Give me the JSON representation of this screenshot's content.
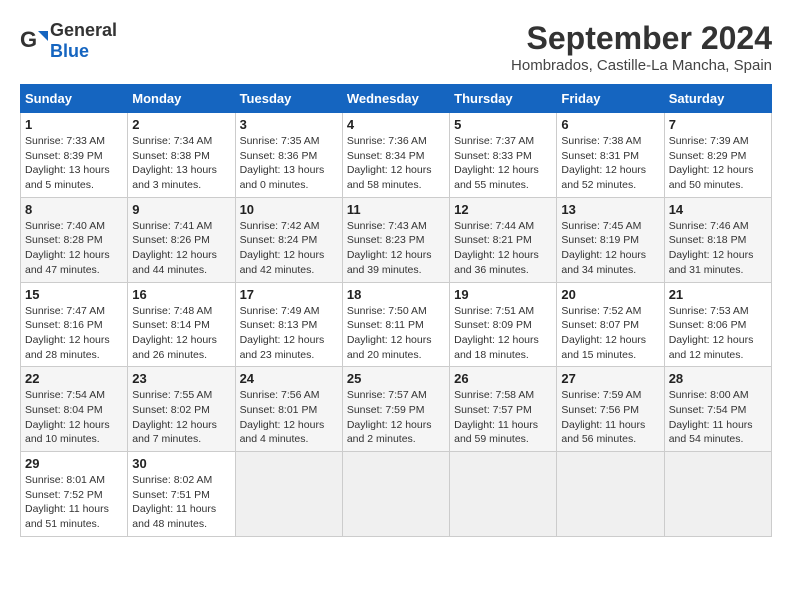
{
  "header": {
    "logo_general": "General",
    "logo_blue": "Blue",
    "month_title": "September 2024",
    "location": "Hombrados, Castille-La Mancha, Spain"
  },
  "calendar": {
    "days_of_week": [
      "Sunday",
      "Monday",
      "Tuesday",
      "Wednesday",
      "Thursday",
      "Friday",
      "Saturday"
    ],
    "weeks": [
      [
        null,
        null,
        null,
        null,
        null,
        null,
        null
      ]
    ],
    "cells": [
      {
        "day": 1,
        "col": 0,
        "sunrise": "7:33 AM",
        "sunset": "8:39 PM",
        "daylight": "13 hours and 5 minutes."
      },
      {
        "day": 2,
        "col": 1,
        "sunrise": "7:34 AM",
        "sunset": "8:38 PM",
        "daylight": "13 hours and 3 minutes."
      },
      {
        "day": 3,
        "col": 2,
        "sunrise": "7:35 AM",
        "sunset": "8:36 PM",
        "daylight": "13 hours and 0 minutes."
      },
      {
        "day": 4,
        "col": 3,
        "sunrise": "7:36 AM",
        "sunset": "8:34 PM",
        "daylight": "12 hours and 58 minutes."
      },
      {
        "day": 5,
        "col": 4,
        "sunrise": "7:37 AM",
        "sunset": "8:33 PM",
        "daylight": "12 hours and 55 minutes."
      },
      {
        "day": 6,
        "col": 5,
        "sunrise": "7:38 AM",
        "sunset": "8:31 PM",
        "daylight": "12 hours and 52 minutes."
      },
      {
        "day": 7,
        "col": 6,
        "sunrise": "7:39 AM",
        "sunset": "8:29 PM",
        "daylight": "12 hours and 50 minutes."
      },
      {
        "day": 8,
        "col": 0,
        "sunrise": "7:40 AM",
        "sunset": "8:28 PM",
        "daylight": "12 hours and 47 minutes."
      },
      {
        "day": 9,
        "col": 1,
        "sunrise": "7:41 AM",
        "sunset": "8:26 PM",
        "daylight": "12 hours and 44 minutes."
      },
      {
        "day": 10,
        "col": 2,
        "sunrise": "7:42 AM",
        "sunset": "8:24 PM",
        "daylight": "12 hours and 42 minutes."
      },
      {
        "day": 11,
        "col": 3,
        "sunrise": "7:43 AM",
        "sunset": "8:23 PM",
        "daylight": "12 hours and 39 minutes."
      },
      {
        "day": 12,
        "col": 4,
        "sunrise": "7:44 AM",
        "sunset": "8:21 PM",
        "daylight": "12 hours and 36 minutes."
      },
      {
        "day": 13,
        "col": 5,
        "sunrise": "7:45 AM",
        "sunset": "8:19 PM",
        "daylight": "12 hours and 34 minutes."
      },
      {
        "day": 14,
        "col": 6,
        "sunrise": "7:46 AM",
        "sunset": "8:18 PM",
        "daylight": "12 hours and 31 minutes."
      },
      {
        "day": 15,
        "col": 0,
        "sunrise": "7:47 AM",
        "sunset": "8:16 PM",
        "daylight": "12 hours and 28 minutes."
      },
      {
        "day": 16,
        "col": 1,
        "sunrise": "7:48 AM",
        "sunset": "8:14 PM",
        "daylight": "12 hours and 26 minutes."
      },
      {
        "day": 17,
        "col": 2,
        "sunrise": "7:49 AM",
        "sunset": "8:13 PM",
        "daylight": "12 hours and 23 minutes."
      },
      {
        "day": 18,
        "col": 3,
        "sunrise": "7:50 AM",
        "sunset": "8:11 PM",
        "daylight": "12 hours and 20 minutes."
      },
      {
        "day": 19,
        "col": 4,
        "sunrise": "7:51 AM",
        "sunset": "8:09 PM",
        "daylight": "12 hours and 18 minutes."
      },
      {
        "day": 20,
        "col": 5,
        "sunrise": "7:52 AM",
        "sunset": "8:07 PM",
        "daylight": "12 hours and 15 minutes."
      },
      {
        "day": 21,
        "col": 6,
        "sunrise": "7:53 AM",
        "sunset": "8:06 PM",
        "daylight": "12 hours and 12 minutes."
      },
      {
        "day": 22,
        "col": 0,
        "sunrise": "7:54 AM",
        "sunset": "8:04 PM",
        "daylight": "12 hours and 10 minutes."
      },
      {
        "day": 23,
        "col": 1,
        "sunrise": "7:55 AM",
        "sunset": "8:02 PM",
        "daylight": "12 hours and 7 minutes."
      },
      {
        "day": 24,
        "col": 2,
        "sunrise": "7:56 AM",
        "sunset": "8:01 PM",
        "daylight": "12 hours and 4 minutes."
      },
      {
        "day": 25,
        "col": 3,
        "sunrise": "7:57 AM",
        "sunset": "7:59 PM",
        "daylight": "12 hours and 2 minutes."
      },
      {
        "day": 26,
        "col": 4,
        "sunrise": "7:58 AM",
        "sunset": "7:57 PM",
        "daylight": "11 hours and 59 minutes."
      },
      {
        "day": 27,
        "col": 5,
        "sunrise": "7:59 AM",
        "sunset": "7:56 PM",
        "daylight": "11 hours and 56 minutes."
      },
      {
        "day": 28,
        "col": 6,
        "sunrise": "8:00 AM",
        "sunset": "7:54 PM",
        "daylight": "11 hours and 54 minutes."
      },
      {
        "day": 29,
        "col": 0,
        "sunrise": "8:01 AM",
        "sunset": "7:52 PM",
        "daylight": "11 hours and 51 minutes."
      },
      {
        "day": 30,
        "col": 1,
        "sunrise": "8:02 AM",
        "sunset": "7:51 PM",
        "daylight": "11 hours and 48 minutes."
      }
    ]
  }
}
